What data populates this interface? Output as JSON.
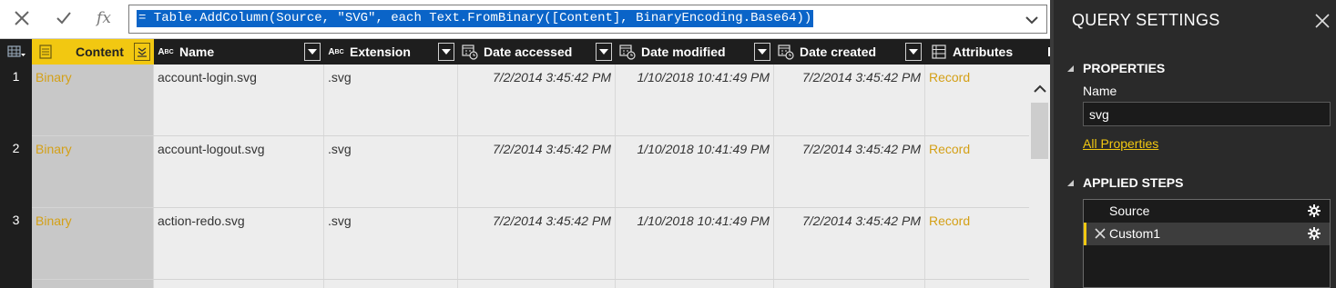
{
  "formula_bar": {
    "formula": "= Table.AddColumn(Source, \"SVG\", each Text.FromBinary([Content], BinaryEncoding.Base64))",
    "fx_label": "fx"
  },
  "grid": {
    "columns": [
      {
        "label": "Content",
        "type_icon": "binary-type-icon"
      },
      {
        "label": "Name",
        "type_icon": "abc-type-icon"
      },
      {
        "label": "Extension",
        "type_icon": "abc-type-icon"
      },
      {
        "label": "Date accessed",
        "type_icon": "datetime-type-icon"
      },
      {
        "label": "Date modified",
        "type_icon": "datetime-type-icon"
      },
      {
        "label": "Date created",
        "type_icon": "datetime-type-icon"
      },
      {
        "label": "Attributes",
        "type_icon": "record-type-icon"
      }
    ],
    "rows": [
      {
        "num": "1",
        "content": "Binary",
        "name": "account-login.svg",
        "extension": ".svg",
        "accessed": "7/2/2014 3:45:42 PM",
        "modified": "1/10/2018 10:41:49 PM",
        "created": "7/2/2014 3:45:42 PM",
        "attributes": "Record"
      },
      {
        "num": "2",
        "content": "Binary",
        "name": "account-logout.svg",
        "extension": ".svg",
        "accessed": "7/2/2014 3:45:42 PM",
        "modified": "1/10/2018 10:41:49 PM",
        "created": "7/2/2014 3:45:42 PM",
        "attributes": "Record"
      },
      {
        "num": "3",
        "content": "Binary",
        "name": "action-redo.svg",
        "extension": ".svg",
        "accessed": "7/2/2014 3:45:42 PM",
        "modified": "1/10/2018 10:41:49 PM",
        "created": "7/2/2014 3:45:42 PM",
        "attributes": "Record"
      }
    ]
  },
  "settings": {
    "title": "QUERY SETTINGS",
    "properties_heading": "PROPERTIES",
    "name_label": "Name",
    "name_value": "svg",
    "all_properties": "All Properties",
    "steps_heading": "APPLIED STEPS",
    "steps": [
      {
        "label": "Source"
      },
      {
        "label": "Custom1"
      }
    ]
  },
  "colors": {
    "accent": "#f2c811",
    "selection": "#0a64c8",
    "link": "#d4a017"
  }
}
